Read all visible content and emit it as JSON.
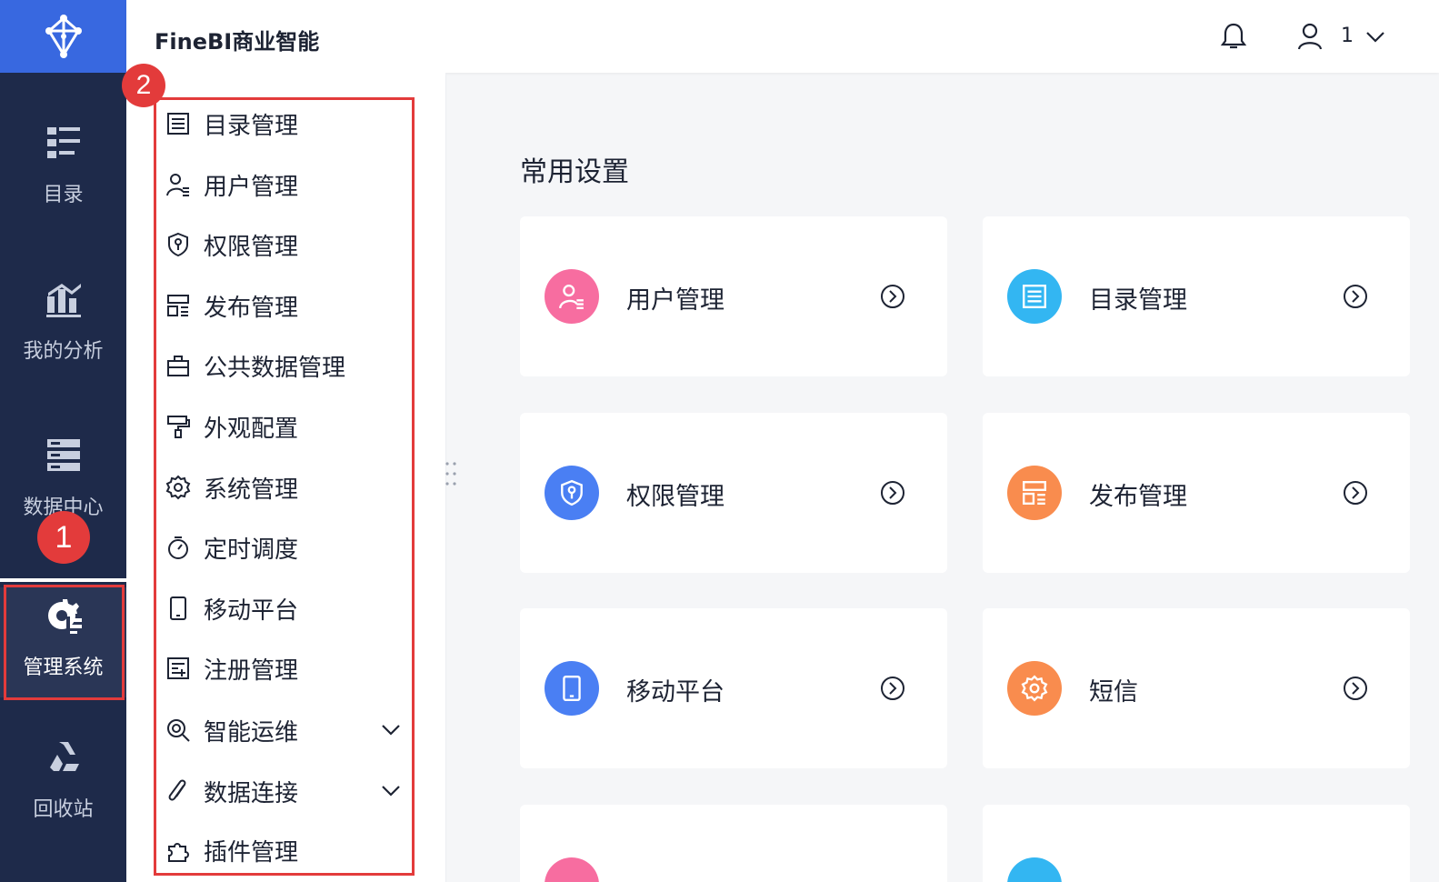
{
  "header": {
    "title": "FineBI商业智能",
    "user_name": "1"
  },
  "rail": {
    "items": [
      {
        "label": "目录",
        "icon": "catalog-icon"
      },
      {
        "label": "我的分析",
        "icon": "analysis-chart-icon"
      },
      {
        "label": "数据中心",
        "icon": "data-center-icon"
      },
      {
        "label": "管理系统",
        "icon": "gear-manage-icon"
      },
      {
        "label": "回收站",
        "icon": "recycle-icon"
      }
    ]
  },
  "submenu": {
    "items": [
      {
        "label": "目录管理",
        "icon": "list-icon"
      },
      {
        "label": "用户管理",
        "icon": "user-icon"
      },
      {
        "label": "权限管理",
        "icon": "shield-icon"
      },
      {
        "label": "发布管理",
        "icon": "publish-icon"
      },
      {
        "label": "公共数据管理",
        "icon": "public-data-icon"
      },
      {
        "label": "外观配置",
        "icon": "paint-roller-icon"
      },
      {
        "label": "系统管理",
        "icon": "gear-icon"
      },
      {
        "label": "定时调度",
        "icon": "timer-icon"
      },
      {
        "label": "移动平台",
        "icon": "mobile-icon"
      },
      {
        "label": "注册管理",
        "icon": "register-icon"
      },
      {
        "label": "智能运维",
        "icon": "ops-search-icon",
        "expandable": true
      },
      {
        "label": "数据连接",
        "icon": "paperclip-icon",
        "expandable": true
      },
      {
        "label": "插件管理",
        "icon": "puzzle-icon"
      }
    ]
  },
  "main": {
    "section_title": "常用设置",
    "cards": [
      {
        "label": "用户管理",
        "icon": "user-icon",
        "color": "#f76da0"
      },
      {
        "label": "目录管理",
        "icon": "list-icon",
        "color": "#33b6f2"
      },
      {
        "label": "权限管理",
        "icon": "shield-icon",
        "color": "#4a7ff3"
      },
      {
        "label": "发布管理",
        "icon": "publish-icon",
        "color": "#f98c4e"
      },
      {
        "label": "移动平台",
        "icon": "mobile-icon",
        "color": "#4a7ff3"
      },
      {
        "label": "短信",
        "icon": "gear-icon",
        "color": "#f98c4e"
      }
    ]
  },
  "callouts": {
    "one": "1",
    "two": "2"
  },
  "colors": {
    "rail_bg": "#1e2a4a",
    "brand": "#3868e0",
    "highlight": "#e33b3b"
  }
}
